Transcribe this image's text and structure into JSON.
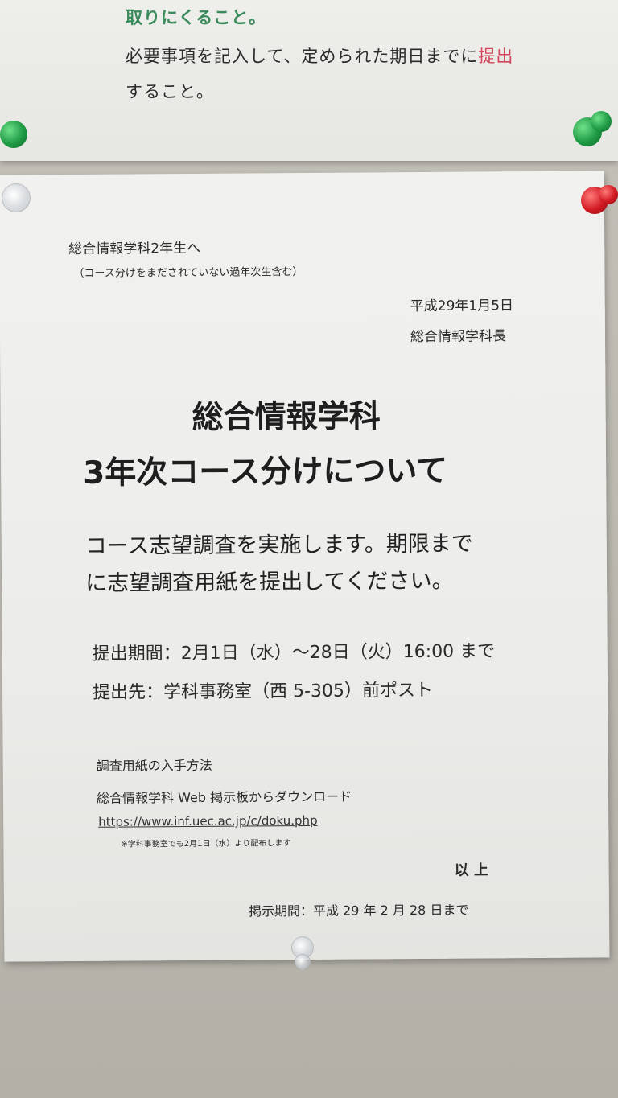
{
  "top_notice": {
    "line1": "取りにくること。",
    "line2_prefix": "必要事項を記入して、定められた期日までに",
    "line2_highlight": "提出",
    "line3": "すること。"
  },
  "notice": {
    "addressee": "総合情報学科2年生へ",
    "addressee_note": "（コース分けをまだされていない過年次生含む）",
    "date": "平成29年1月5日",
    "issuer": "総合情報学科長",
    "title_line1": "総合情報学科",
    "title_line2": "3年次コース分けについて",
    "body_line1": "コース志望調査を実施します。期限まで",
    "body_line2": "に志望調査用紙を提出してください。",
    "period": "提出期間：2月1日（水）～28日（火）16:00 まで",
    "destination": "提出先：学科事務室（西 5-305）前ポスト",
    "howto_heading": "調査用紙の入手方法",
    "howto_text": "総合情報学科 Web 掲示板からダウンロード",
    "url": "https://www.inf.uec.ac.jp/c/doku.php",
    "footnote": "※学科事務室でも2月1日（水）より配布します",
    "closing": "以 上",
    "posting_period": "掲示期間：平成 29 年 2 月 28 日まで"
  },
  "colors": {
    "board": "#bdbab2",
    "paper": "#eeeeec",
    "accent_green": "#3a8a5c",
    "accent_red": "#d2455a",
    "pin_green": "#1f9a44",
    "pin_red": "#d11a22"
  }
}
